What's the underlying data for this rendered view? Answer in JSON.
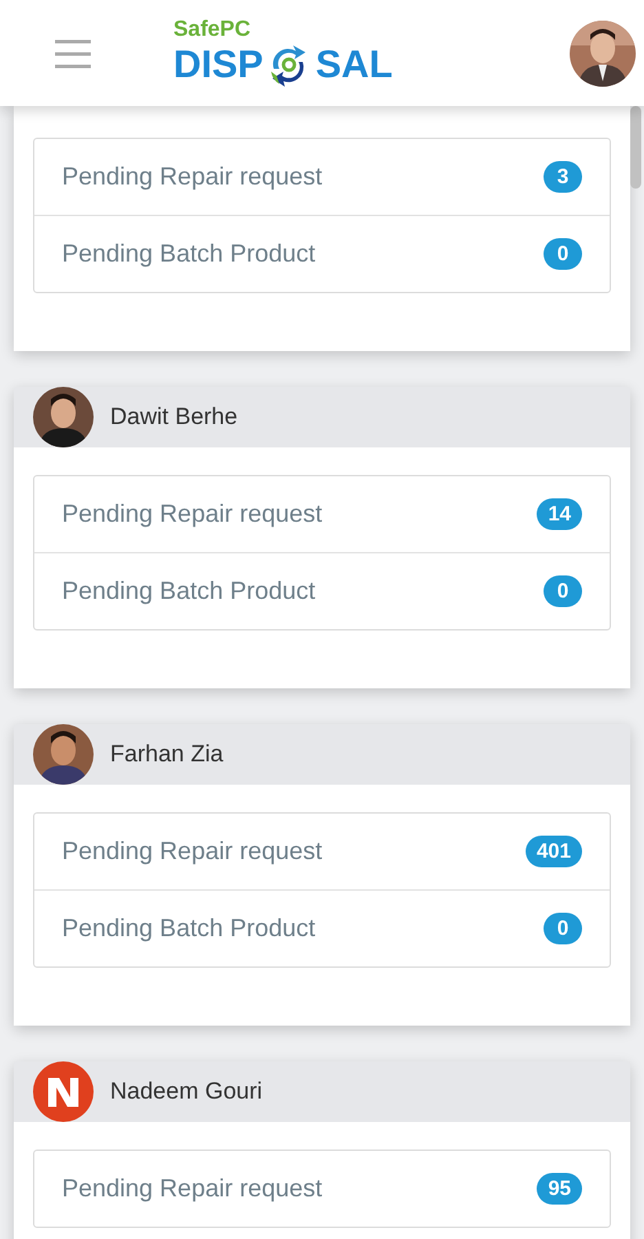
{
  "header": {
    "logo": {
      "top": "SafePC",
      "left": "DISP",
      "right": "SAL"
    }
  },
  "cards": [
    {
      "items": [
        {
          "label": "Pending Repair request",
          "count": "3"
        },
        {
          "label": "Pending Batch Product",
          "count": "0"
        }
      ]
    },
    {
      "user": "Dawit Berhe",
      "items": [
        {
          "label": "Pending Repair request",
          "count": "14"
        },
        {
          "label": "Pending Batch Product",
          "count": "0"
        }
      ]
    },
    {
      "user": "Farhan Zia",
      "items": [
        {
          "label": "Pending Repair request",
          "count": "401"
        },
        {
          "label": "Pending Batch Product",
          "count": "0"
        }
      ]
    },
    {
      "user": "Nadeem Gouri",
      "items": [
        {
          "label": "Pending Repair request",
          "count": "95"
        }
      ]
    }
  ]
}
